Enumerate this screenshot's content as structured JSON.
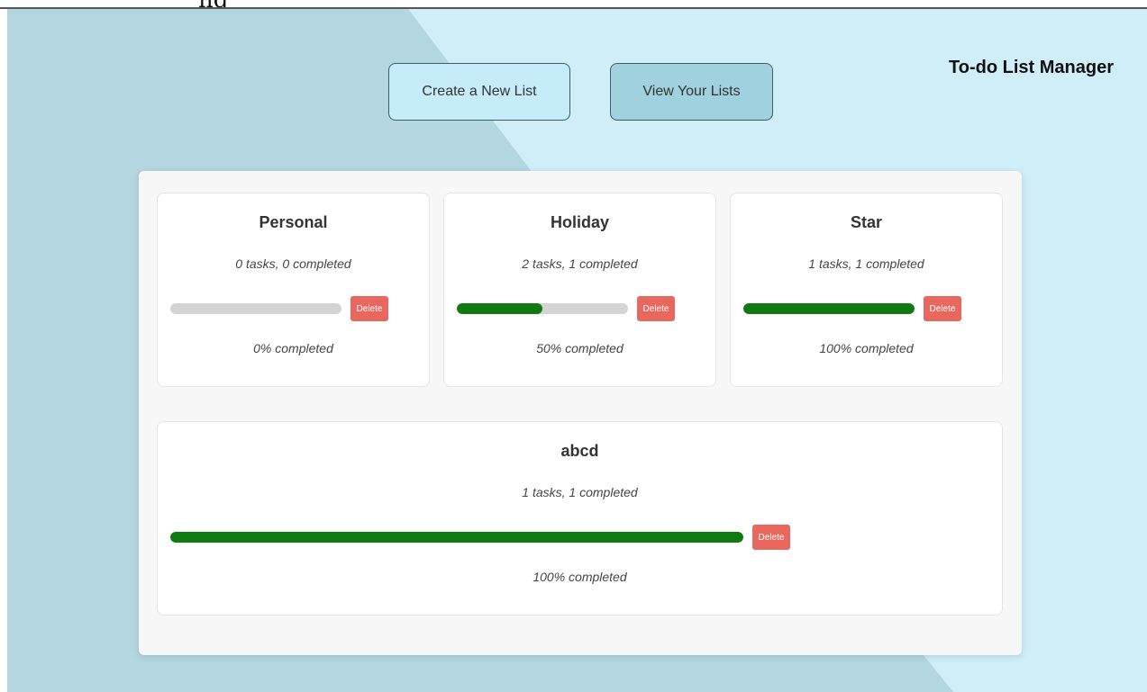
{
  "app": {
    "title": "To-do List Manager",
    "top_clip_text": "ng"
  },
  "nav": {
    "create_label": "Create a New List",
    "view_label": "View Your Lists"
  },
  "colors": {
    "bg_left": "#b4d6e0",
    "bg_right": "#cfeef8",
    "progress": "#0f7a0f",
    "delete": "#e8685f"
  },
  "lists": [
    {
      "title": "Personal",
      "tasks_text": "0 tasks, 0 completed",
      "percent": 0,
      "pct_text": "0% completed",
      "delete_label": "Delete"
    },
    {
      "title": "Holiday",
      "tasks_text": "2 tasks, 1 completed",
      "percent": 50,
      "pct_text": "50% completed",
      "delete_label": "Delete"
    },
    {
      "title": "Star",
      "tasks_text": "1 tasks, 1 completed",
      "percent": 100,
      "pct_text": "100% completed",
      "delete_label": "Delete"
    },
    {
      "title": "abcd",
      "tasks_text": "1 tasks, 1 completed",
      "percent": 100,
      "pct_text": "100% completed",
      "delete_label": "Delete"
    }
  ]
}
